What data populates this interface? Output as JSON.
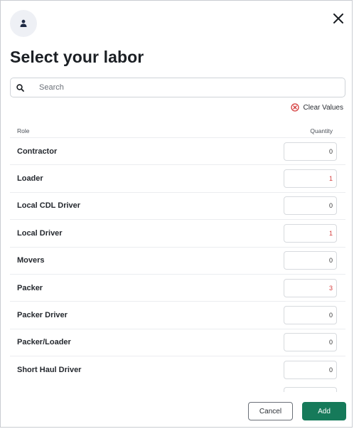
{
  "dialog": {
    "title": "Select your labor",
    "close_icon": "close-icon",
    "avatar_icon": "person-icon"
  },
  "search": {
    "placeholder": "Search",
    "value": "",
    "icon": "search-icon"
  },
  "clear_values": {
    "label": "Clear Values",
    "icon": "clear-circle-icon",
    "color": "#d43a3a"
  },
  "table": {
    "headers": {
      "role": "Role",
      "quantity": "Quantity"
    },
    "rows": [
      {
        "role": "Contractor",
        "quantity": "0"
      },
      {
        "role": "Loader",
        "quantity": "1"
      },
      {
        "role": "Local CDL Driver",
        "quantity": "0"
      },
      {
        "role": "Local Driver",
        "quantity": "1"
      },
      {
        "role": "Movers",
        "quantity": "0"
      },
      {
        "role": "Packer",
        "quantity": "3"
      },
      {
        "role": "Packer Driver",
        "quantity": "0"
      },
      {
        "role": "Packer/Loader",
        "quantity": "0"
      },
      {
        "role": "Short Haul Driver",
        "quantity": "0"
      }
    ]
  },
  "footer": {
    "cancel_label": "Cancel",
    "add_label": "Add",
    "add_color": "#167a5a"
  }
}
